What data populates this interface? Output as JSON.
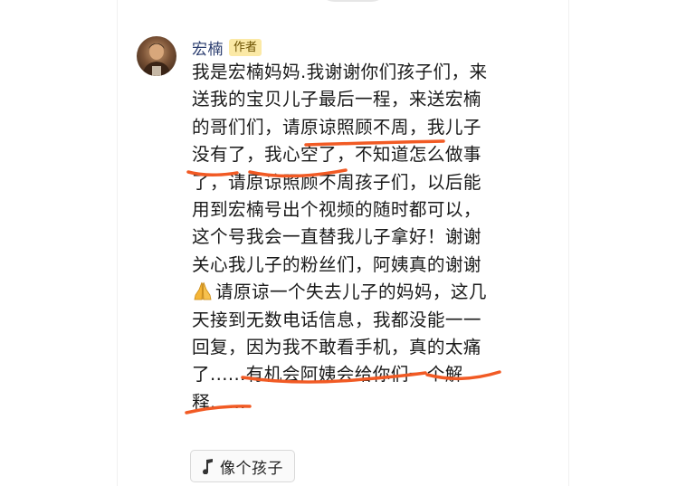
{
  "author": {
    "name": "宏楠",
    "badge": "作者"
  },
  "comment": {
    "lines": [
      "我是宏楠妈妈.我谢谢你们孩子们，来",
      "送我的宝贝儿子最后一程，来送宏楠",
      "的哥们们，请原谅照顾不周，我儿子",
      "没有了，我心空了，不知道怎么做事",
      "了，请原谅照顾不周孩子们，以后能",
      "用到宏楠号出个视频的随时都可以，",
      "这个号我会一直替我儿子拿好！谢谢",
      "关心我儿子的粉丝们，阿姨真的谢谢",
      "请原谅一个失去儿子的妈妈，这几",
      "天接到无数电话信息，我都没能一一",
      "回复，因为我不敢看手机，真的太痛",
      "了......有机会阿姨会给你们一个解",
      "释......"
    ],
    "emoji_icon": "folded-hands-icon"
  },
  "tag": {
    "icon": "music-note-icon",
    "label": "像个孩子"
  },
  "colors": {
    "author_name": "#2a3c6e",
    "badge_bg": "#fbe9a6",
    "badge_text": "#6b5100",
    "underline": "#f15a24",
    "text": "#1a1a1a"
  }
}
